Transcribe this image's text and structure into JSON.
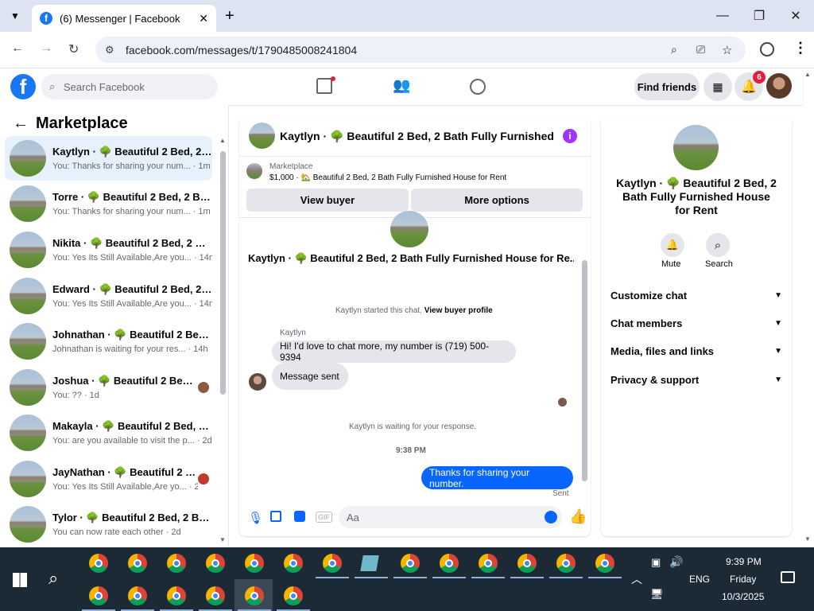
{
  "browser": {
    "tab_title": "(6) Messenger | Facebook",
    "url": "facebook.com/messages/t/1790485008241804"
  },
  "fb": {
    "search_placeholder": "Search Facebook",
    "find_friends": "Find friends",
    "notif_count": "6"
  },
  "left": {
    "title": "Marketplace",
    "conversations": [
      {
        "name": "Kaytlyn · 🌳 Beautiful 2 Bed, 2 B...",
        "preview": "You: Thanks for sharing your num... · 1m"
      },
      {
        "name": "Torre · 🌳 Beautiful 2 Bed, 2 Bat...",
        "preview": "You: Thanks for sharing your num... · 1m"
      },
      {
        "name": "Nikita · 🌳 Beautiful 2 Bed, 2 Ba...",
        "preview": "You: Yes Its Still Available,Are you... · 14m"
      },
      {
        "name": "Edward · 🌳 Beautiful 2 Bed, 2 B...",
        "preview": "You: Yes Its Still Available,Are you... · 14m"
      },
      {
        "name": "Johnathan · 🌳 Beautiful 2 Bed, ...",
        "preview": "Johnathan is waiting for your res... · 14h"
      },
      {
        "name": "Joshua · 🌳 Beautiful 2 Bed, 2...",
        "preview": "You: ?? · 1d"
      },
      {
        "name": "Makayla · 🌳 Beautiful 2 Bed, 2 ...",
        "preview": "You: are you available to visit the p... · 2d"
      },
      {
        "name": "JayNathan · 🌳 Beautiful 2 Be...",
        "preview": "You: Yes Its Still Available,Are yo... · 2d"
      },
      {
        "name": "Tylor · 🌳 Beautiful 2 Bed, 2 Bat...",
        "preview": "You can now rate each other · 2d"
      }
    ]
  },
  "chat": {
    "header_title": "Kaytlyn · 🌳 Beautiful 2 Bed, 2 Bath Fully Furnished H...",
    "marketplace_label": "Marketplace",
    "listing_price": "$1,000 · 🏡 Beautiful 2 Bed, 2 Bath Fully Furnished House for Rent",
    "view_buyer": "View buyer",
    "more_options": "More options",
    "thread_title": "Kaytlyn · 🌳 Beautiful 2 Bed, 2 Bath Fully Furnished House for Re...",
    "started_text": "Kaytlyn started this chat.",
    "view_buyer_profile": "View buyer profile",
    "sender_name": "Kaytlyn",
    "msg1": "Hi! I'd love to chat more, my number is (719) 500-9394",
    "msg2": "Message sent",
    "waiting": "Kaytlyn is waiting for your response.",
    "time": "9:38 PM",
    "my_msg": "Thanks for sharing your number.",
    "sent": "Sent",
    "input_placeholder": "Aa"
  },
  "right": {
    "title": "Kaytlyn · 🌳 Beautiful 2 Bed, 2 Bath Fully Furnished House for Rent",
    "mute": "Mute",
    "search": "Search",
    "sections": [
      "Customize chat",
      "Chat members",
      "Media, files and links",
      "Privacy & support"
    ]
  },
  "taskbar": {
    "time": "9:39 PM",
    "day": "Friday",
    "date": "10/3/2025",
    "lang": "ENG"
  },
  "colors": {
    "brand": "#1877f2",
    "accent": "#0866ff",
    "purple": "#a033ff",
    "notif": "#e41e3f"
  }
}
